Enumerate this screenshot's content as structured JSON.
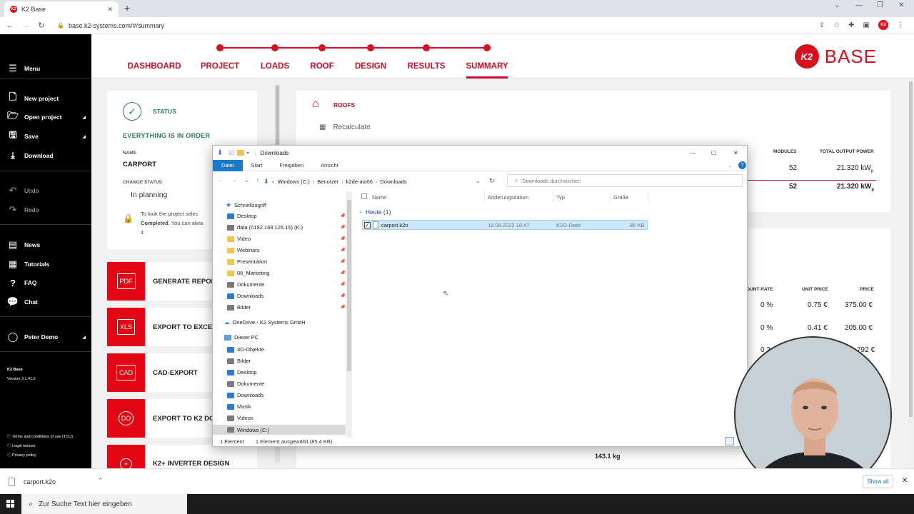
{
  "browser": {
    "tab_title": "K2 Base",
    "new_tab": "+",
    "url": "base.k2-systems.com/#/summary",
    "profile_initials": "K2"
  },
  "sidebar": {
    "menu_label": "Menu",
    "items": [
      {
        "label": "New project",
        "icon": "new-file-icon"
      },
      {
        "label": "Open project",
        "icon": "folder-open-icon"
      },
      {
        "label": "Save",
        "icon": "save-icon"
      },
      {
        "label": "Download",
        "icon": "download-icon"
      },
      {
        "label": "Undo",
        "icon": "undo-icon"
      },
      {
        "label": "Redo",
        "icon": "redo-icon"
      },
      {
        "label": "News",
        "icon": "news-icon"
      },
      {
        "label": "Tutorials",
        "icon": "tutorials-icon"
      },
      {
        "label": "FAQ",
        "icon": "help-icon"
      },
      {
        "label": "Chat",
        "icon": "chat-icon"
      },
      {
        "label": "Peter Demo",
        "icon": "user-icon"
      }
    ],
    "app_name": "K2 Base",
    "version": "Version 3.1.41.2",
    "links": [
      "Terms and conditions of use (TCU)",
      "Legal notices",
      "Privacy policy"
    ]
  },
  "topnav": {
    "steps": [
      "DASHBOARD",
      "PROJECT",
      "LOADS",
      "ROOF",
      "DESIGN",
      "RESULTS",
      "SUMMARY"
    ],
    "active": "SUMMARY",
    "logo_mark": "K2",
    "logo_text": "BASE"
  },
  "status_card": {
    "title": "STATUS",
    "message": "EVERYTHING IS IN ORDER",
    "name_label": "NAME",
    "name_value": "CARPORT",
    "change_status_label": "CHANGE STATUS",
    "status_value": "In planning",
    "lock_text_1": "To look the project selec",
    "lock_text_2a": "Completed",
    "lock_text_2b": ". You can alwa",
    "lock_text_3": "it."
  },
  "exports": [
    {
      "icon": "PDF",
      "label": "GENERATE REPOR"
    },
    {
      "icon": "XLS",
      "label": "EXPORT TO EXCE"
    },
    {
      "icon": "CAD",
      "label": "CAD-EXPORT"
    },
    {
      "icon": "DO",
      "label": "EXPORT TO K2 DO"
    },
    {
      "icon": "+",
      "label": "K2+ INVERTER DESIGN"
    }
  ],
  "roofs_card": {
    "title": "ROOFS",
    "recalculate": "Recalculate",
    "headers": [
      "MODULES",
      "TOTAL OUTPUT POWER"
    ],
    "rows": [
      {
        "modules": "52",
        "power": "21.320 kW",
        "unit_sub": "p"
      },
      {
        "modules": "52",
        "power": "21.320 kW",
        "unit_sub": "p"
      }
    ]
  },
  "price_card": {
    "headers": [
      "OUNT RATE",
      "UNIT PRICE",
      "PRICE"
    ],
    "rows": [
      {
        "rate": "0 %",
        "unit": "0.75 €",
        "price": "375.00 €"
      },
      {
        "rate": "0 %",
        "unit": "0.41 €",
        "price": "205.00 €"
      },
      {
        "rate": "0 2",
        "unit": "",
        "price": "792 €"
      }
    ],
    "weight": "143.1 kg"
  },
  "explorer": {
    "title": "Downloads",
    "tabs": [
      "Datei",
      "Start",
      "Freigeben",
      "Ansicht"
    ],
    "path": [
      "Windows (C:)",
      "Benutzer",
      "k2de-aio06",
      "Downloads"
    ],
    "search_placeholder": "Downloads durchsuchen",
    "quick_access": "Schnellzugriff",
    "nav": [
      {
        "label": "Desktop",
        "type": "blue",
        "pinned": true
      },
      {
        "label": "data (\\\\192.168.126.15) (K:)",
        "type": "drive",
        "pinned": true
      },
      {
        "label": "Video",
        "type": "folder",
        "pinned": true
      },
      {
        "label": "Webinars",
        "type": "folder",
        "pinned": true
      },
      {
        "label": "Presentation",
        "type": "folder",
        "pinned": true
      },
      {
        "label": "06_Marketing",
        "type": "folder",
        "pinned": true
      },
      {
        "label": "Dokumente",
        "type": "drive",
        "pinned": true
      },
      {
        "label": "Downloads",
        "type": "blue",
        "pinned": true
      },
      {
        "label": "Bilder",
        "type": "drive",
        "pinned": true
      }
    ],
    "onedrive": "OneDrive - K2 Systems GmbH",
    "this_pc": "Dieser PC",
    "pc_items": [
      {
        "label": "3D-Objekte",
        "type": "blue"
      },
      {
        "label": "Bilder",
        "type": "drive"
      },
      {
        "label": "Desktop",
        "type": "blue"
      },
      {
        "label": "Dokumente",
        "type": "drive"
      },
      {
        "label": "Downloads",
        "type": "blue"
      },
      {
        "label": "Musik",
        "type": "blue"
      },
      {
        "label": "Videos",
        "type": "drive"
      },
      {
        "label": "Windows (C:)",
        "type": "drive"
      }
    ],
    "columns": [
      "Name",
      "Änderungsdatum",
      "Typ",
      "Größe"
    ],
    "group": "Heute (1)",
    "file": {
      "name": "carport.k2o",
      "date": "18.08.2022 16:47",
      "type": "K2O-Datei",
      "size": "86 KB"
    },
    "status_count": "1 Element",
    "status_selected": "1 Element ausgewählt (85,4 KB)"
  },
  "download_bar": {
    "file": "carport.k2o",
    "show_all": "Show all"
  },
  "taskbar": {
    "search_placeholder": "Zur Suche Text hier eingeben"
  }
}
